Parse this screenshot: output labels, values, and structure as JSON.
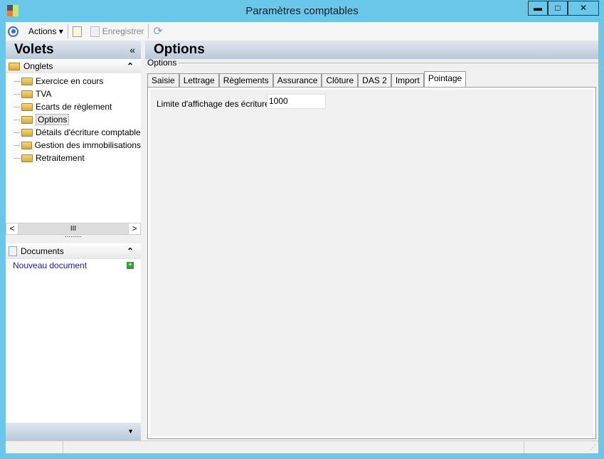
{
  "window": {
    "title": "Paramètres comptables",
    "minimize": "▬",
    "maximize": "□",
    "close": "✕"
  },
  "toolbar": {
    "actions": "Actions",
    "save": "Enregistrer"
  },
  "left": {
    "title": "Volets",
    "collapse": "«",
    "tabs_section": "Onglets",
    "expand": "⌃",
    "items": [
      "Exercice en cours",
      "TVA",
      "Ecarts de règlement",
      "Options",
      "Détails d'écriture comptable",
      "Gestion des immobilisations",
      "Retraitement"
    ],
    "scroll_left": "<",
    "scroll_thumb": "III",
    "scroll_right": ">",
    "documents_section": "Documents",
    "new_document": "Nouveau document",
    "bottom_arrow": "▼"
  },
  "main": {
    "title": "Options",
    "group": "Options",
    "tabs": [
      "Saisie",
      "Lettrage",
      "Règlements",
      "Assurance",
      "Clôture",
      "DAS 2",
      "Import",
      "Pointage"
    ],
    "field_label": "Limite d'affichage des écritures :",
    "field_value": "1000"
  }
}
